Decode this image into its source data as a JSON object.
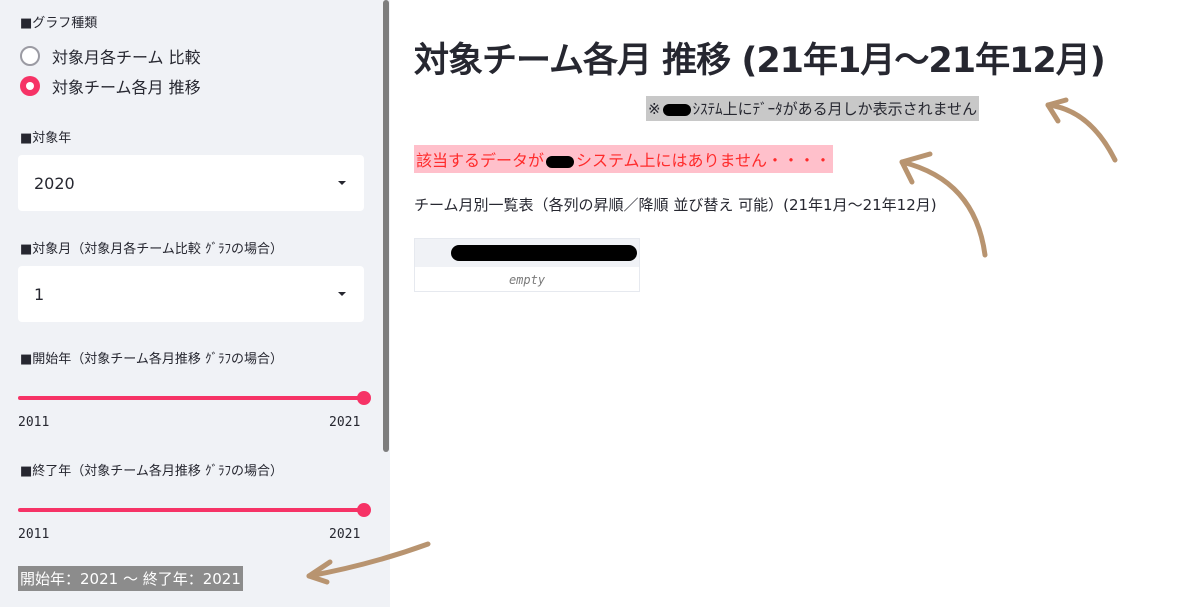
{
  "sidebar": {
    "graph_type": {
      "label": "■グラフ種類",
      "options": [
        "対象月各チーム 比較",
        "対象チーム各月 推移"
      ],
      "selected_index": 1
    },
    "target_year": {
      "label": "■対象年",
      "value": "2020"
    },
    "target_month": {
      "label": "■対象月（対象月各チーム比較 ｸﾞﾗﾌの場合）",
      "value": "1"
    },
    "start_year": {
      "label": "■開始年（対象チーム各月推移 ｸﾞﾗﾌの場合）",
      "min": "2011",
      "max": "2021",
      "value": 2021
    },
    "end_year": {
      "label": "■終了年（対象チーム各月推移 ｸﾞﾗﾌの場合）",
      "min": "2011",
      "max": "2021",
      "value": 2021
    },
    "range_text": "開始年：2021 〜 終了年：2021"
  },
  "main": {
    "title": "対象チーム各月 推移 (21年1月〜21年12月)",
    "note_prefix": "※",
    "note_suffix": "ｼｽﾃﾑ上にﾃﾞｰﾀがある月しか表示されません",
    "warning_prefix": "該当するデータが",
    "warning_suffix": "システム上にはありません・・・・",
    "table_heading": "チーム月別一覧表（各列の昇順／降順 並び替え 可能）(21年1月〜21年12月)",
    "table_empty": "empty"
  },
  "colors": {
    "accent": "#f63366",
    "sidebar_bg": "#f0f2f6",
    "warning_text": "#ff2b2b",
    "warning_bg": "#ffc0cb",
    "note_bg": "#c8c8c8",
    "annotation_arrow": "#b89470"
  }
}
